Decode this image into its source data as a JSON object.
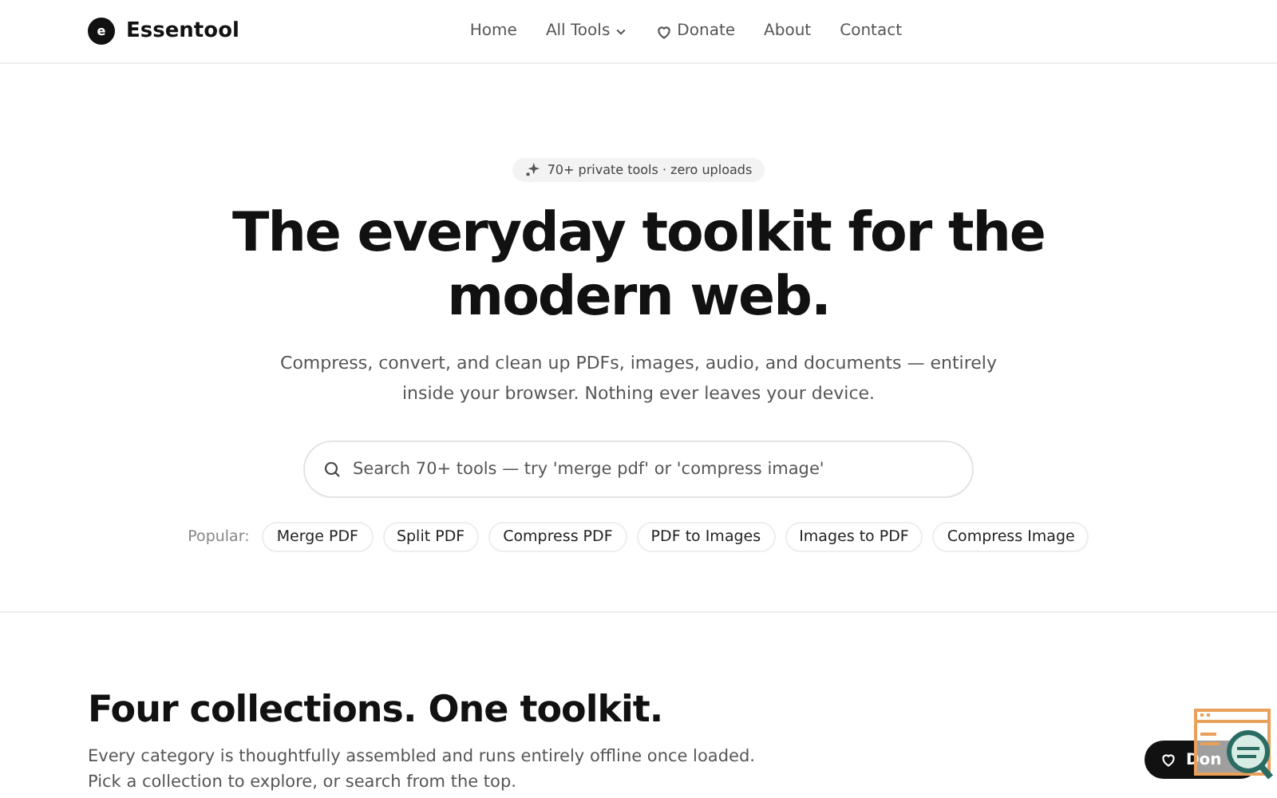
{
  "header": {
    "logo_letter": "e",
    "brand": "Essentool",
    "nav": [
      {
        "label": "Home",
        "kind": "link"
      },
      {
        "label": "All Tools",
        "kind": "dropdown"
      },
      {
        "label": "Donate",
        "kind": "heart"
      },
      {
        "label": "About",
        "kind": "link"
      },
      {
        "label": "Contact",
        "kind": "link"
      }
    ]
  },
  "hero": {
    "badge": "70+ private tools · zero uploads",
    "title": "The everyday toolkit for the modern web.",
    "subtitle": "Compress, convert, and clean up PDFs, images, audio, and documents — entirely inside your browser. Nothing ever leaves your device.",
    "search": {
      "placeholder": "Search 70+ tools — try 'merge pdf' or 'compress image'"
    },
    "popular_label": "Popular:",
    "popular": [
      "Merge PDF",
      "Split PDF",
      "Compress PDF",
      "PDF to Images",
      "Images to PDF",
      "Compress Image"
    ]
  },
  "collections": {
    "title": "Four collections. One toolkit.",
    "description": "Every category is thoughtfully assembled and runs entirely offline once loaded. Pick a collection to explore, or search from the top."
  },
  "floating_donate": {
    "label": "Don"
  }
}
